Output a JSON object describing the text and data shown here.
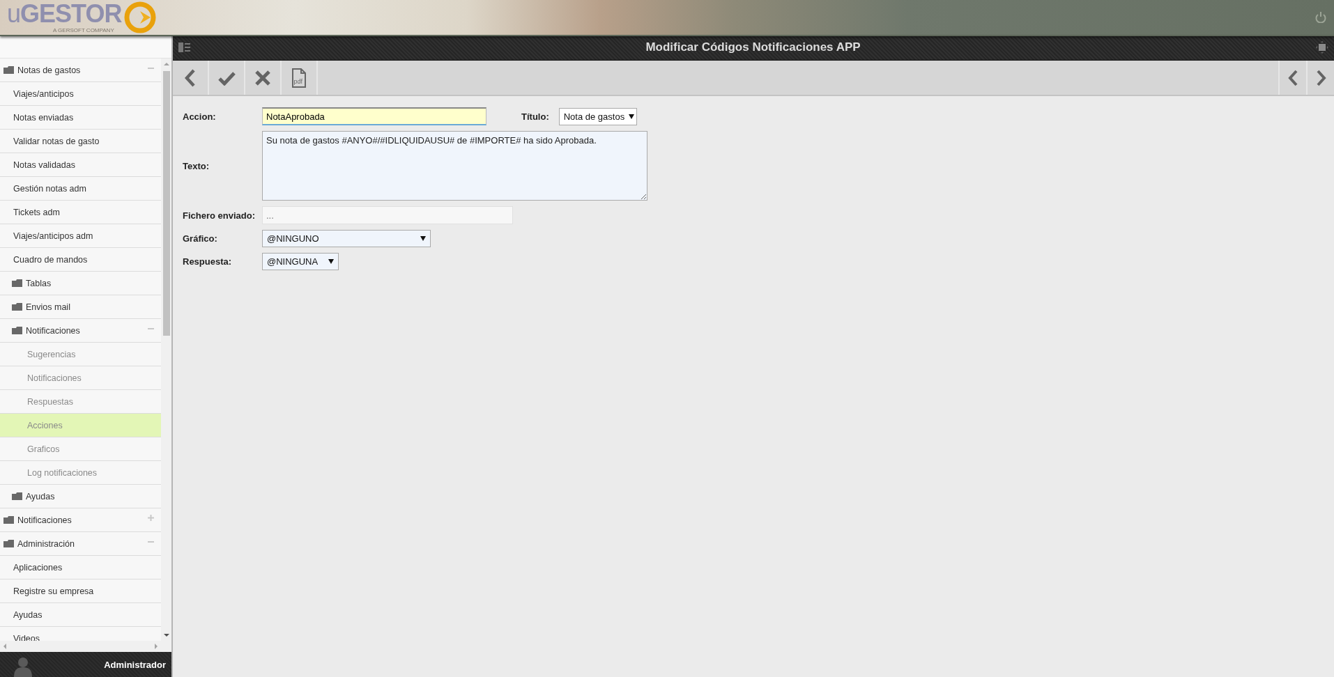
{
  "header": {
    "logo": "uGESTOR",
    "tagline": "A GERSOFT COMPANY"
  },
  "sidebar": {
    "items": [
      {
        "label": "Notas de gastos",
        "kind": "folder",
        "expanded": true,
        "selected": false,
        "children": [
          {
            "label": "Viajes/anticipos",
            "kind": "link",
            "selected": false
          },
          {
            "label": "Notas enviadas",
            "kind": "link",
            "selected": false
          },
          {
            "label": "Validar notas de gasto",
            "kind": "link",
            "selected": false
          },
          {
            "label": "Notas validadas",
            "kind": "link",
            "selected": false
          },
          {
            "label": "Gestión notas adm",
            "kind": "link",
            "selected": false
          },
          {
            "label": "Tickets adm",
            "kind": "link",
            "selected": false
          },
          {
            "label": "Viajes/anticipos adm",
            "kind": "link",
            "selected": false
          },
          {
            "label": "Cuadro de mandos",
            "kind": "link",
            "selected": false
          },
          {
            "label": "Tablas",
            "kind": "folder",
            "selected": false
          },
          {
            "label": "Envios mail",
            "kind": "folder",
            "selected": false
          },
          {
            "label": "Notificaciones",
            "kind": "folder",
            "expanded": true,
            "selected": false,
            "children": [
              {
                "label": "Sugerencias",
                "kind": "link",
                "selected": false
              },
              {
                "label": "Notificaciones",
                "kind": "link",
                "selected": false
              },
              {
                "label": "Respuestas",
                "kind": "link",
                "selected": false
              },
              {
                "label": "Acciones",
                "kind": "link",
                "selected": true
              },
              {
                "label": "Graficos",
                "kind": "link",
                "selected": false
              },
              {
                "label": "Log notificaciones",
                "kind": "link",
                "selected": false
              }
            ]
          },
          {
            "label": "Ayudas",
            "kind": "folder",
            "selected": false
          }
        ]
      },
      {
        "label": "Notificaciones",
        "kind": "folder",
        "expanded": false,
        "selected": false
      },
      {
        "label": "Administración",
        "kind": "folder",
        "expanded": true,
        "selected": false,
        "children": [
          {
            "label": "Aplicaciones",
            "kind": "link",
            "selected": false
          },
          {
            "label": "Registre su empresa",
            "kind": "link",
            "selected": false
          },
          {
            "label": "Ayudas",
            "kind": "link",
            "selected": false
          },
          {
            "label": "Videos",
            "kind": "link",
            "selected": false
          }
        ]
      }
    ],
    "user": "Administrador"
  },
  "title_bar": {
    "title": "Modificar Códigos Notificaciones APP"
  },
  "toolbar": {
    "pdf_label": "pdf"
  },
  "form": {
    "accion": {
      "label": "Accion:",
      "value": "NotaAprobada"
    },
    "titulo": {
      "label": "Título:",
      "value": "Nota de gastos"
    },
    "texto": {
      "label": "Texto:",
      "value": "Su nota de gastos #ANYO#/#IDLIQUIDAUSU# de #IMPORTE# ha sido Aprobada."
    },
    "fichero": {
      "label": "Fichero enviado:",
      "placeholder": "..."
    },
    "grafico": {
      "label": "Gráfico:",
      "value": "@NINGUNO"
    },
    "respuesta": {
      "label": "Respuesta:",
      "value": "@NINGUNA"
    }
  }
}
